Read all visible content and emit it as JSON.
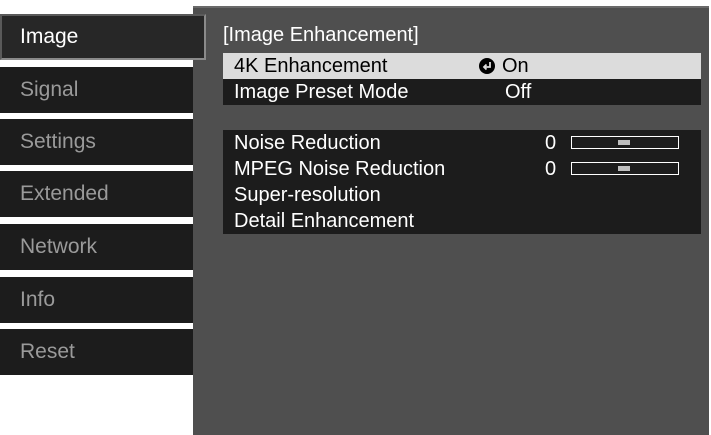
{
  "menu": {
    "tabs": [
      {
        "label": "Image"
      },
      {
        "label": "Signal"
      },
      {
        "label": "Settings"
      },
      {
        "label": "Extended"
      },
      {
        "label": "Network"
      },
      {
        "label": "Info"
      },
      {
        "label": "Reset"
      }
    ]
  },
  "panel": {
    "title": "[Image Enhancement]",
    "items": [
      {
        "label": "4K Enhancement",
        "value": "On",
        "icon": "enter-icon"
      },
      {
        "label": "Image Preset Mode",
        "value": "Off"
      },
      {
        "label": "Noise Reduction",
        "value": "0",
        "slider_level": 0.4
      },
      {
        "label": "MPEG Noise Reduction",
        "value": "0",
        "slider_level": 0.4
      },
      {
        "label": "Super-resolution"
      },
      {
        "label": "Detail Enhancement"
      }
    ]
  },
  "colors": {
    "panel_bg": "#4f4f4f",
    "row_bg": "#1c1c1c",
    "selected_bg": "#dcdcdc"
  }
}
